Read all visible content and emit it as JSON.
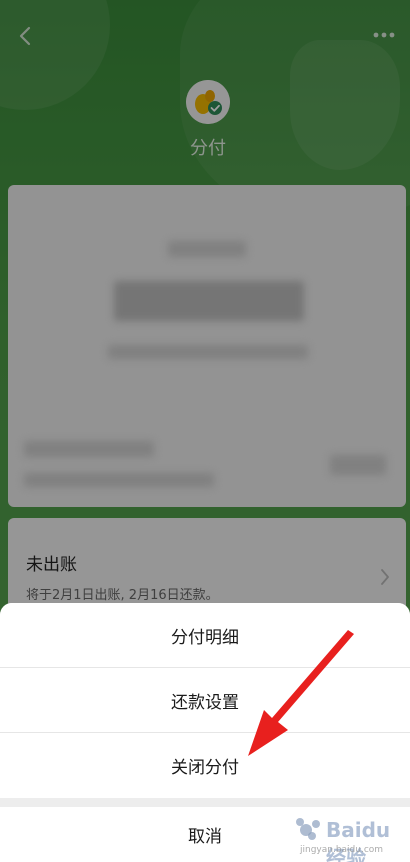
{
  "header": {
    "brand_name": "分付"
  },
  "bill": {
    "title": "未出账",
    "description": "将于2月1日出账, 2月16日还款。"
  },
  "action_sheet": {
    "items": [
      {
        "label": "分付明细"
      },
      {
        "label": "还款设置"
      },
      {
        "label": "关闭分付"
      }
    ],
    "cancel_label": "取消"
  },
  "watermark": {
    "text": "Baidu经验",
    "url_text": "jingyan.baidu.com"
  },
  "colors": {
    "brand_green": "#4e9c48",
    "annotation_red": "#e8201e"
  },
  "icons": [
    "back-arrow-icon",
    "more-dots-icon",
    "fenfu-logo-icon",
    "chevron-right-icon",
    "red-arrow-annotation-icon"
  ]
}
